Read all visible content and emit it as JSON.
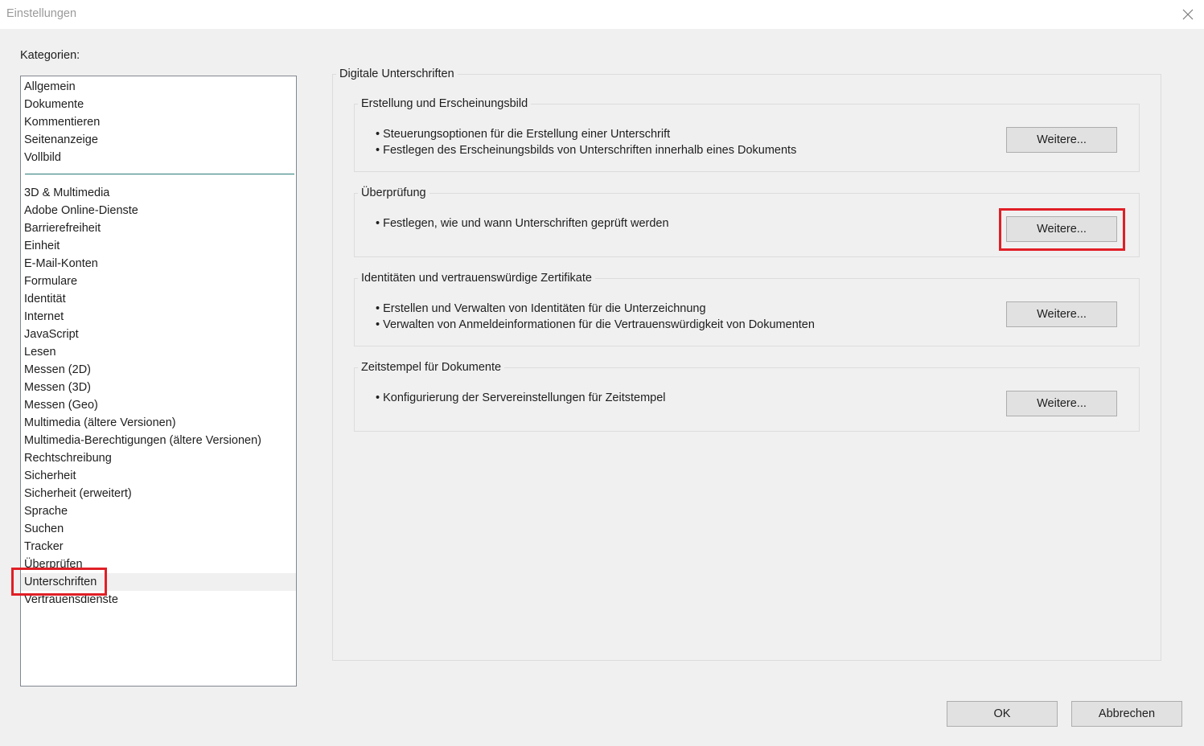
{
  "window": {
    "title": "Einstellungen",
    "close_icon": "close-icon"
  },
  "categories": {
    "label": "Kategorien:",
    "top_items": [
      "Allgemein",
      "Dokumente",
      "Kommentieren",
      "Seitenanzeige",
      "Vollbild"
    ],
    "items": [
      "3D & Multimedia",
      "Adobe Online-Dienste",
      "Barrierefreiheit",
      "Einheit",
      "E-Mail-Konten",
      "Formulare",
      "Identität",
      "Internet",
      "JavaScript",
      "Lesen",
      "Messen (2D)",
      "Messen (3D)",
      "Messen (Geo)",
      "Multimedia (ältere Versionen)",
      "Multimedia-Berechtigungen (ältere Versionen)",
      "Rechtschreibung",
      "Sicherheit",
      "Sicherheit (erweitert)",
      "Sprache",
      "Suchen",
      "Tracker",
      "Überprüfen",
      "Unterschriften",
      "Vertrauensdienste"
    ],
    "selected": "Unterschriften"
  },
  "panel": {
    "title": "Digitale Unterschriften",
    "sections": [
      {
        "title": "Erstellung und Erscheinungsbild",
        "bullets": [
          "• Steuerungsoptionen für die Erstellung einer Unterschrift",
          "• Festlegen des Erscheinungsbilds von Unterschriften innerhalb eines Dokuments"
        ],
        "button": "Weitere..."
      },
      {
        "title": "Überprüfung",
        "bullets": [
          "• Festlegen, wie und wann Unterschriften geprüft werden"
        ],
        "button": "Weitere..."
      },
      {
        "title": "Identitäten und vertrauenswürdige Zertifikate",
        "bullets": [
          "• Erstellen und Verwalten von Identitäten für die Unterzeichnung",
          "• Verwalten von Anmeldeinformationen für die Vertrauenswürdigkeit von Dokumenten"
        ],
        "button": "Weitere..."
      },
      {
        "title": "Zeitstempel für Dokumente",
        "bullets": [
          "• Konfigurierung der Servereinstellungen für Zeitstempel"
        ],
        "button": "Weitere..."
      }
    ]
  },
  "footer": {
    "ok": "OK",
    "cancel": "Abbrechen"
  },
  "colors": {
    "highlight": "#e01f26",
    "separator": "#2a7a78",
    "background": "#f0f0f0"
  }
}
